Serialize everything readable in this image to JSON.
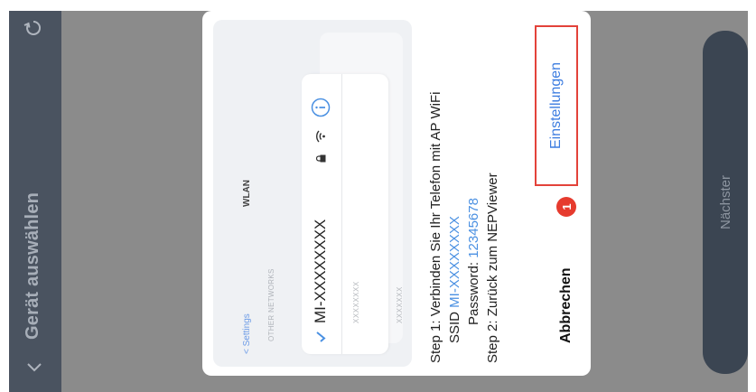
{
  "header": {
    "title": "Gerät auswählen"
  },
  "footer": {
    "next_label": "Nächster"
  },
  "dialog": {
    "illustration": {
      "back_label": "< Settings",
      "title": "WLAN",
      "other_networks": "OTHER NETWORKS",
      "ssid": "MI-XXXXXXXX",
      "rows": [
        "XXXXXXXX",
        "XXXXXXX"
      ]
    },
    "step1": "Step 1: Verbinden Sie Ihr Telefon mit AP WiFi",
    "ssid_prefix": "SSID ",
    "ssid_value": "MI-XXXXXXXX",
    "password_prefix": "Password: ",
    "password_value": "12345678",
    "step2": "Step 2: Zurück zum NEPViewer",
    "cancel_label": "Abbrechen",
    "badge": "1",
    "settings_label": "Einstellungen"
  },
  "colors": {
    "accent": "#4a90e2",
    "highlight_border": "#e3423a",
    "badge": "#e63b2e",
    "topbar": "#4a5360",
    "next_button": "#3b4552"
  }
}
